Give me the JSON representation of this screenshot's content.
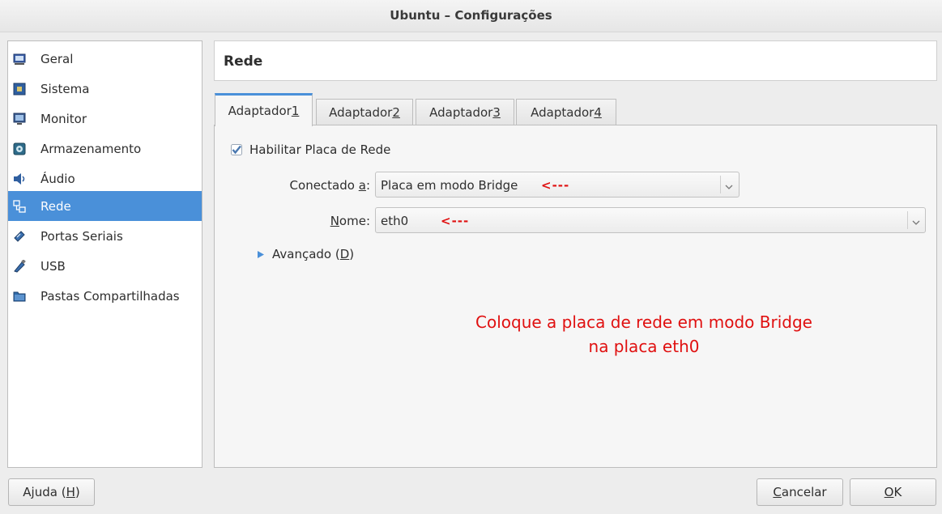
{
  "window": {
    "title": "Ubuntu – Configurações"
  },
  "sidebar": {
    "items": [
      {
        "label": "Geral",
        "icon": "monitor-general-icon",
        "active": false
      },
      {
        "label": "Sistema",
        "icon": "chip-icon",
        "active": false
      },
      {
        "label": "Monitor",
        "icon": "display-icon",
        "active": false
      },
      {
        "label": "Armazenamento",
        "icon": "disk-icon",
        "active": false
      },
      {
        "label": "Áudio",
        "icon": "speaker-icon",
        "active": false
      },
      {
        "label": "Rede",
        "icon": "network-icon",
        "active": true
      },
      {
        "label": "Portas Seriais",
        "icon": "serial-port-icon",
        "active": false
      },
      {
        "label": "USB",
        "icon": "usb-icon",
        "active": false
      },
      {
        "label": "Pastas Compartilhadas",
        "icon": "folder-icon",
        "active": false
      }
    ]
  },
  "header": {
    "title": "Rede"
  },
  "tabs": [
    {
      "label": "Adaptador ",
      "mnemonic": "1",
      "active": true
    },
    {
      "label": "Adaptador ",
      "mnemonic": "2",
      "active": false
    },
    {
      "label": "Adaptador ",
      "mnemonic": "3",
      "active": false
    },
    {
      "label": "Adaptador ",
      "mnemonic": "4",
      "active": false
    }
  ],
  "form": {
    "enable_checkbox": {
      "label": "Habilitar Placa de Rede",
      "checked": true
    },
    "attached_to": {
      "label_pre": "Conectado ",
      "label_mnemonic": "a",
      "label_post": ":",
      "value": "Placa em modo Bridge",
      "marker": "<---"
    },
    "name": {
      "label_mnemonic": "N",
      "label_post": "ome:",
      "value": "eth0",
      "marker": "<---"
    },
    "advanced": {
      "label_pre": "Avançado (",
      "label_mnemonic": "D",
      "label_post": ")"
    }
  },
  "annotation": {
    "line1": "Coloque a placa de rede em modo Bridge",
    "line2": "na placa eth0"
  },
  "buttons": {
    "help": {
      "label_pre": "Ajuda (",
      "label_mnemonic": "H",
      "label_post": ")"
    },
    "cancel": {
      "label_mnemonic": "C",
      "label_post": "ancelar"
    },
    "ok": {
      "label_mnemonic": "O",
      "label_post": "K"
    }
  },
  "colors": {
    "accent": "#4a90d9",
    "annotation": "#e01010"
  }
}
